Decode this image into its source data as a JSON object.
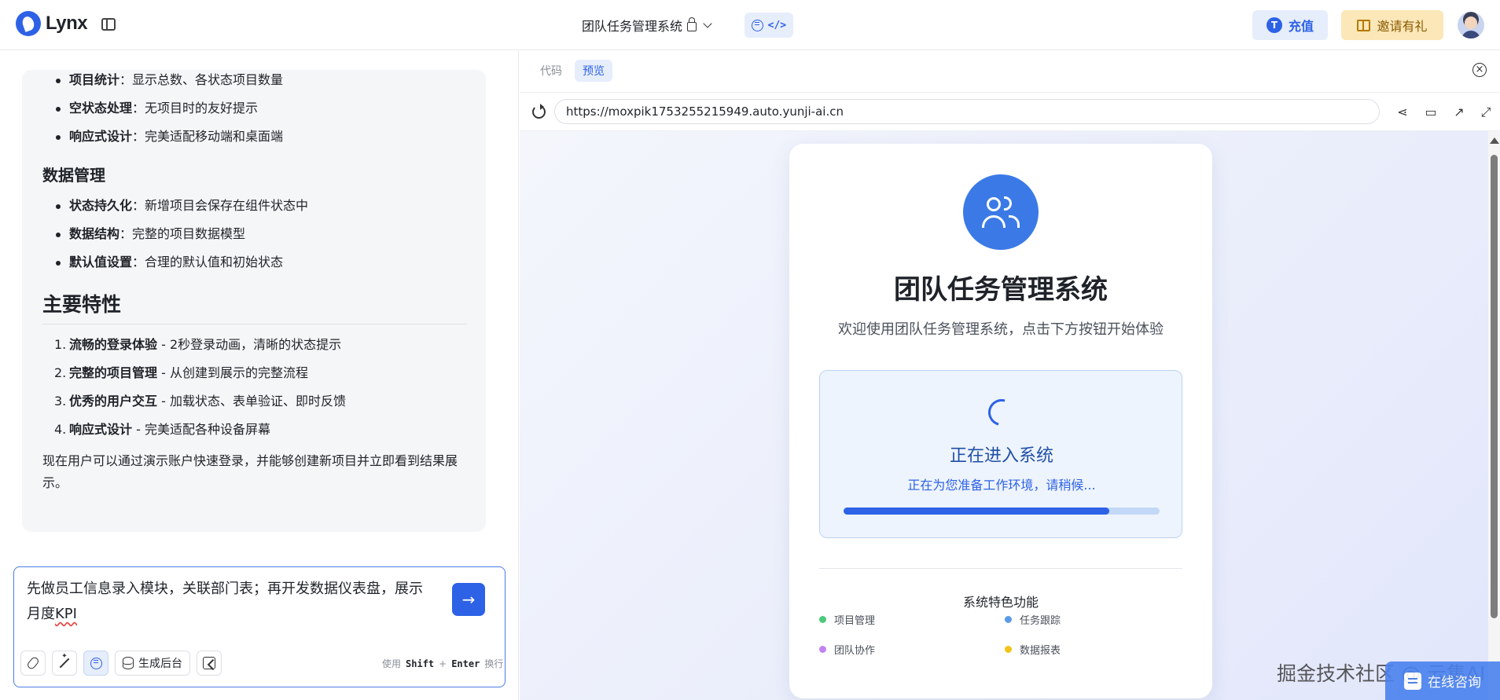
{
  "header": {
    "logo_text": "Lynx",
    "project_title": "团队任务管理系统",
    "recharge_label": "充值",
    "recharge_icon_glyph": "T",
    "invite_label": "邀请有礼"
  },
  "chat": {
    "top_bullets": [
      {
        "bold": "项目统计",
        "text": "：显示总数、各状态项目数量"
      },
      {
        "bold": "空状态处理",
        "text": "：无项目时的友好提示"
      },
      {
        "bold": "响应式设计",
        "text": "：完美适配移动端和桌面端"
      }
    ],
    "data_heading": "数据管理",
    "data_bullets": [
      {
        "bold": "状态持久化",
        "text": "：新增项目会保存在组件状态中"
      },
      {
        "bold": "数据结构",
        "text": "：完整的项目数据模型"
      },
      {
        "bold": "默认值设置",
        "text": "：合理的默认值和初始状态"
      }
    ],
    "features_heading": "主要特性",
    "features": [
      {
        "num": "1.",
        "bold": "流畅的登录体验",
        "text": " - 2秒登录动画，清晰的状态提示"
      },
      {
        "num": "2.",
        "bold": "完整的项目管理",
        "text": " - 从创建到展示的完整流程"
      },
      {
        "num": "3.",
        "bold": "优秀的用户交互",
        "text": " - 加载状态、表单验证、即时反馈"
      },
      {
        "num": "4.",
        "bold": "响应式设计",
        "text": " - 完美适配各种设备屏幕"
      }
    ],
    "closing_text": "现在用户可以通过演示账户快速登录，并能够创建新项目并立即看到结果展示。"
  },
  "input": {
    "value_line1": "先做员工信息录入模块，关联部门表；再开发数据仪表盘，展示",
    "value_line2_prefix": "月度",
    "value_line2_flagged": "KPI",
    "send_glyph": "→",
    "generate_backend_label": "生成后台",
    "hint_use": "使用",
    "hint_shift": "Shift",
    "hint_plus": "+",
    "hint_enter": "Enter",
    "hint_newline": "换行"
  },
  "preview": {
    "tab_code": "代码",
    "tab_preview": "预览",
    "close_glyph": "×",
    "url": "https://moxpik1753255215949.auto.yunji-ai.cn",
    "card_title": "团队任务管理系统",
    "card_subtitle": "欢迎使用团队任务管理系统，点击下方按钮开始体验",
    "loading_title": "正在进入系统",
    "loading_subtitle": "正在为您准备工作环境，请稍候...",
    "progress": 0.84,
    "features_title": "系统特色功能",
    "features": [
      {
        "label": "项目管理",
        "color": "#4cc97a"
      },
      {
        "label": "任务跟踪",
        "color": "#5a9be8"
      },
      {
        "label": "团队协作",
        "color": "#c084f0"
      },
      {
        "label": "数据报表",
        "color": "#f0c419"
      }
    ]
  },
  "overlay": {
    "watermark": "掘金技术社区 @ 云集AI",
    "consult_label": "在线咨询"
  },
  "colors": {
    "accent": "#2d62e6",
    "invite_bg": "#fbe7b8"
  }
}
